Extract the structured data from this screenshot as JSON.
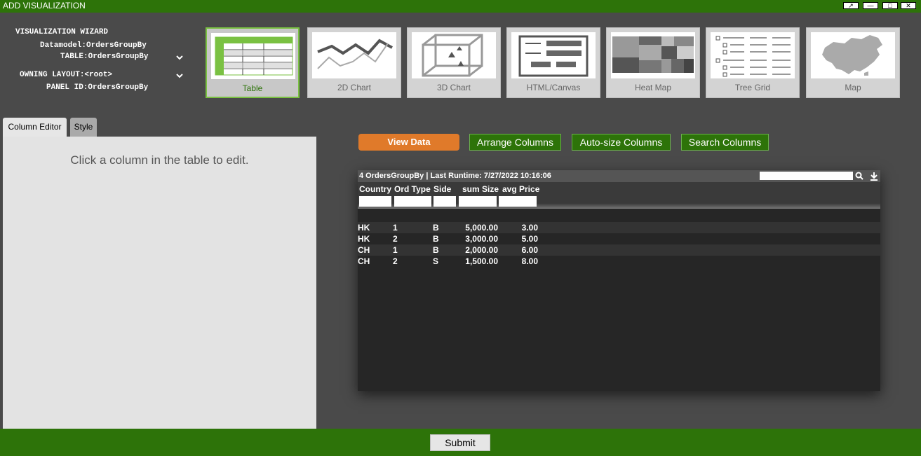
{
  "window": {
    "title": "ADD VISUALIZATION",
    "buttons": [
      "↗",
      "—",
      "□",
      "✕"
    ]
  },
  "wizard": {
    "title": "VISUALIZATION WIZARD",
    "datamodel_label": "Datamodel:",
    "datamodel_value": "OrdersGroupBy",
    "table_label": "TABLE:",
    "table_value": "OrdersGroupBy",
    "owning_layout_label": "OWNING LAYOUT:",
    "owning_layout_value": "<root>",
    "panel_id_label": "PANEL ID:",
    "panel_id_value": "OrdersGroupBy"
  },
  "viz_types": [
    {
      "label": "Table",
      "icon": "table-icon",
      "selected": true
    },
    {
      "label": "2D Chart",
      "icon": "line-chart-icon"
    },
    {
      "label": "3D Chart",
      "icon": "cube-chart-icon"
    },
    {
      "label": "HTML/Canvas",
      "icon": "html-canvas-icon"
    },
    {
      "label": "Heat Map",
      "icon": "heat-map-icon"
    },
    {
      "label": "Tree Grid",
      "icon": "tree-grid-icon"
    },
    {
      "label": "Map",
      "icon": "map-icon"
    }
  ],
  "tabs": {
    "column_editor": "Column Editor",
    "style": "Style"
  },
  "editor": {
    "message": "Click a column in the table to edit."
  },
  "actions": {
    "view_data": "View Data",
    "arrange_columns": "Arrange Columns",
    "autosize_columns": "Auto-size Columns",
    "search_columns": "Search Columns"
  },
  "table": {
    "header": "4 OrdersGroupBy | Last Runtime: 7/27/2022 10:16:06",
    "columns": [
      "Country",
      "Ord Type",
      "Side",
      "sum Size",
      "avg Price"
    ],
    "rows": [
      [
        "HK",
        "1",
        "B",
        "5,000.00",
        "3.00"
      ],
      [
        "HK",
        "2",
        "B",
        "3,000.00",
        "5.00"
      ],
      [
        "CH",
        "1",
        "B",
        "2,000.00",
        "6.00"
      ],
      [
        "CH",
        "2",
        "S",
        "1,500.00",
        "8.00"
      ]
    ]
  },
  "footer": {
    "submit": "Submit"
  },
  "colors": {
    "titlebar": "#2d7309",
    "accent_orange": "#e07a2a",
    "selected_border": "#7ac142"
  }
}
